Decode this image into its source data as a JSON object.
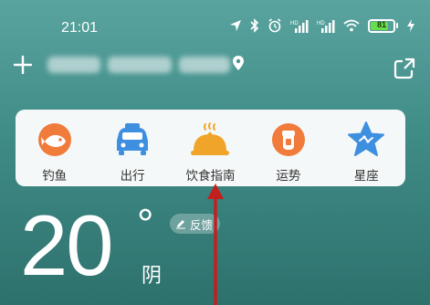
{
  "status_bar": {
    "time": "21:01",
    "battery_level": "81",
    "battery_fraction": 0.81,
    "battery_color": "#6bdc4b",
    "icons": [
      "location-arrow-icon",
      "bluetooth-icon",
      "alarm-icon",
      "signal-hd-icon",
      "signal-hd-icon",
      "wifi-icon",
      "battery-icon",
      "charging-icon"
    ]
  },
  "header": {
    "add_icon": "plus-icon",
    "location_icon": "location-pin-icon",
    "share_icon": "share-icon"
  },
  "services": [
    {
      "label": "钓鱼",
      "icon": "fish-icon",
      "color": "#f07b3a"
    },
    {
      "label": "出行",
      "icon": "car-icon",
      "color": "#3f8fe0"
    },
    {
      "label": "饮食指南",
      "icon": "food-cloche-icon",
      "color": "#f0a52a"
    },
    {
      "label": "运势",
      "icon": "fortune-icon",
      "color": "#f07b3a"
    },
    {
      "label": "星座",
      "icon": "star-icon",
      "color": "#3f8fe0"
    }
  ],
  "weather": {
    "temperature": "20",
    "degree_symbol": "°",
    "condition": "阴",
    "feedback_label": "反馈"
  },
  "annotation": {
    "arrow_color": "#c21f1f"
  }
}
